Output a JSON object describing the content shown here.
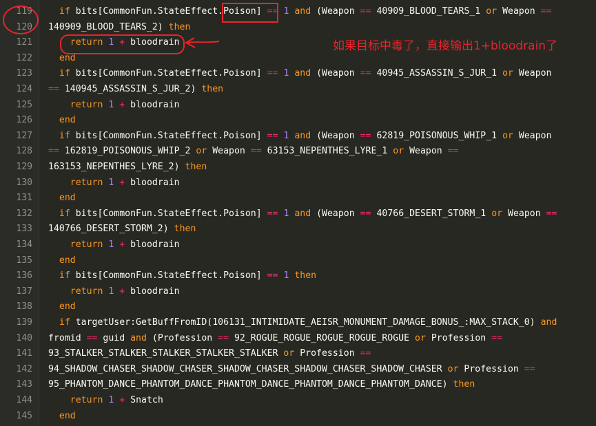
{
  "editor": {
    "line_numbers": [
      "119",
      "120",
      "121",
      "122",
      "123",
      "124",
      "125",
      "126",
      "127",
      "128",
      "129",
      "130",
      "131",
      "132",
      "133",
      "134",
      "135",
      "136",
      "137",
      "138",
      "139",
      "140",
      "141",
      "142",
      "143",
      "144",
      "145"
    ],
    "lines": [
      [
        {
          "t": "  ",
          "c": "id"
        },
        {
          "t": "if ",
          "c": "kw"
        },
        {
          "t": "bits[CommonFun.StateEffect.Poison] ",
          "c": "id"
        },
        {
          "t": "== ",
          "c": "kw2"
        },
        {
          "t": "1 ",
          "c": "num"
        },
        {
          "t": "and ",
          "c": "kw"
        },
        {
          "t": "(Weapon ",
          "c": "id"
        },
        {
          "t": "== ",
          "c": "kw2"
        },
        {
          "t": "40909_BLOOD_TEARS_1 ",
          "c": "id"
        },
        {
          "t": "or ",
          "c": "kw"
        },
        {
          "t": "Weapon ",
          "c": "id"
        },
        {
          "t": "==",
          "c": "kw2"
        }
      ],
      [
        {
          "t": "140909_BLOOD_TEARS_2) ",
          "c": "id"
        },
        {
          "t": "then",
          "c": "kw"
        }
      ],
      [
        {
          "t": "    ",
          "c": "id"
        },
        {
          "t": "return ",
          "c": "kw"
        },
        {
          "t": "1 ",
          "c": "num"
        },
        {
          "t": "+ ",
          "c": "kw2"
        },
        {
          "t": "bloodrain",
          "c": "id"
        }
      ],
      [
        {
          "t": "  ",
          "c": "id"
        },
        {
          "t": "end",
          "c": "kw"
        }
      ],
      [
        {
          "t": "  ",
          "c": "id"
        },
        {
          "t": "if ",
          "c": "kw"
        },
        {
          "t": "bits[CommonFun.StateEffect.Poison] ",
          "c": "id"
        },
        {
          "t": "== ",
          "c": "kw2"
        },
        {
          "t": "1 ",
          "c": "num"
        },
        {
          "t": "and ",
          "c": "kw"
        },
        {
          "t": "(Weapon ",
          "c": "id"
        },
        {
          "t": "== ",
          "c": "kw2"
        },
        {
          "t": "40945_ASSASSIN_S_JUR_1 ",
          "c": "id"
        },
        {
          "t": "or ",
          "c": "kw"
        },
        {
          "t": "Weapon",
          "c": "id"
        }
      ],
      [
        {
          "t": "== ",
          "c": "kw2"
        },
        {
          "t": "140945_ASSASSIN_S_JUR_2) ",
          "c": "id"
        },
        {
          "t": "then",
          "c": "kw"
        }
      ],
      [
        {
          "t": "    ",
          "c": "id"
        },
        {
          "t": "return ",
          "c": "kw"
        },
        {
          "t": "1 ",
          "c": "num"
        },
        {
          "t": "+ ",
          "c": "kw2"
        },
        {
          "t": "bloodrain",
          "c": "id"
        }
      ],
      [
        {
          "t": "  ",
          "c": "id"
        },
        {
          "t": "end",
          "c": "kw"
        }
      ],
      [
        {
          "t": "  ",
          "c": "id"
        },
        {
          "t": "if ",
          "c": "kw"
        },
        {
          "t": "bits[CommonFun.StateEffect.Poison] ",
          "c": "id"
        },
        {
          "t": "== ",
          "c": "kw2"
        },
        {
          "t": "1 ",
          "c": "num"
        },
        {
          "t": "and ",
          "c": "kw"
        },
        {
          "t": "(Weapon ",
          "c": "id"
        },
        {
          "t": "== ",
          "c": "kw2"
        },
        {
          "t": "62819_POISONOUS_WHIP_1 ",
          "c": "id"
        },
        {
          "t": "or ",
          "c": "kw"
        },
        {
          "t": "Weapon",
          "c": "id"
        }
      ],
      [
        {
          "t": "== ",
          "c": "kw2"
        },
        {
          "t": "162819_POISONOUS_WHIP_2 ",
          "c": "id"
        },
        {
          "t": "or ",
          "c": "kw"
        },
        {
          "t": "Weapon ",
          "c": "id"
        },
        {
          "t": "== ",
          "c": "kw2"
        },
        {
          "t": "63153_NEPENTHES_LYRE_1 ",
          "c": "id"
        },
        {
          "t": "or ",
          "c": "kw"
        },
        {
          "t": "Weapon ",
          "c": "id"
        },
        {
          "t": "==",
          "c": "kw2"
        }
      ],
      [
        {
          "t": "163153_NEPENTHES_LYRE_2) ",
          "c": "id"
        },
        {
          "t": "then",
          "c": "kw"
        }
      ],
      [
        {
          "t": "    ",
          "c": "id"
        },
        {
          "t": "return ",
          "c": "kw"
        },
        {
          "t": "1 ",
          "c": "num"
        },
        {
          "t": "+ ",
          "c": "kw2"
        },
        {
          "t": "bloodrain",
          "c": "id"
        }
      ],
      [
        {
          "t": "  ",
          "c": "id"
        },
        {
          "t": "end",
          "c": "kw"
        }
      ],
      [
        {
          "t": "  ",
          "c": "id"
        },
        {
          "t": "if ",
          "c": "kw"
        },
        {
          "t": "bits[CommonFun.StateEffect.Poison] ",
          "c": "id"
        },
        {
          "t": "== ",
          "c": "kw2"
        },
        {
          "t": "1 ",
          "c": "num"
        },
        {
          "t": "and ",
          "c": "kw"
        },
        {
          "t": "(Weapon ",
          "c": "id"
        },
        {
          "t": "== ",
          "c": "kw2"
        },
        {
          "t": "40766_DESERT_STORM_1 ",
          "c": "id"
        },
        {
          "t": "or ",
          "c": "kw"
        },
        {
          "t": "Weapon ",
          "c": "id"
        },
        {
          "t": "==",
          "c": "kw2"
        }
      ],
      [
        {
          "t": "140766_DESERT_STORM_2) ",
          "c": "id"
        },
        {
          "t": "then",
          "c": "kw"
        }
      ],
      [
        {
          "t": "    ",
          "c": "id"
        },
        {
          "t": "return ",
          "c": "kw"
        },
        {
          "t": "1 ",
          "c": "num"
        },
        {
          "t": "+ ",
          "c": "kw2"
        },
        {
          "t": "bloodrain",
          "c": "id"
        }
      ],
      [
        {
          "t": "  ",
          "c": "id"
        },
        {
          "t": "end",
          "c": "kw"
        }
      ],
      [
        {
          "t": "  ",
          "c": "id"
        },
        {
          "t": "if ",
          "c": "kw"
        },
        {
          "t": "bits[CommonFun.StateEffect.Poison] ",
          "c": "id"
        },
        {
          "t": "== ",
          "c": "kw2"
        },
        {
          "t": "1 ",
          "c": "num"
        },
        {
          "t": "then",
          "c": "kw"
        }
      ],
      [
        {
          "t": "    ",
          "c": "id"
        },
        {
          "t": "return ",
          "c": "kw"
        },
        {
          "t": "1 ",
          "c": "num"
        },
        {
          "t": "+ ",
          "c": "kw2"
        },
        {
          "t": "bloodrain",
          "c": "id"
        }
      ],
      [
        {
          "t": "  ",
          "c": "id"
        },
        {
          "t": "end",
          "c": "kw"
        }
      ],
      [
        {
          "t": "  ",
          "c": "id"
        },
        {
          "t": "if ",
          "c": "kw"
        },
        {
          "t": "targetUser:GetBuffFromID(106131_INTIMIDATE_AEISR_MONUMENT_DAMAGE_BONUS_:MAX_STACK_0) ",
          "c": "id"
        },
        {
          "t": "and",
          "c": "kw"
        }
      ],
      [
        {
          "t": "fromid ",
          "c": "id"
        },
        {
          "t": "== ",
          "c": "kw2"
        },
        {
          "t": "guid ",
          "c": "id"
        },
        {
          "t": "and ",
          "c": "kw"
        },
        {
          "t": "(Profession ",
          "c": "id"
        },
        {
          "t": "== ",
          "c": "kw2"
        },
        {
          "t": "92_ROGUE_ROGUE_ROGUE_ROGUE_ROGUE ",
          "c": "id"
        },
        {
          "t": "or ",
          "c": "kw"
        },
        {
          "t": "Profession ",
          "c": "id"
        },
        {
          "t": "==",
          "c": "kw2"
        }
      ],
      [
        {
          "t": "93_STALKER_STALKER_STALKER_STALKER_STALKER ",
          "c": "id"
        },
        {
          "t": "or ",
          "c": "kw"
        },
        {
          "t": "Profession ",
          "c": "id"
        },
        {
          "t": "==",
          "c": "kw2"
        }
      ],
      [
        {
          "t": "94_SHADOW_CHASER_SHADOW_CHASER_SHADOW_CHASER_SHADOW_CHASER_SHADOW_CHASER ",
          "c": "id"
        },
        {
          "t": "or ",
          "c": "kw"
        },
        {
          "t": "Profession ",
          "c": "id"
        },
        {
          "t": "==",
          "c": "kw2"
        }
      ],
      [
        {
          "t": "95_PHANTOM_DANCE_PHANTOM_DANCE_PHANTOM_DANCE_PHANTOM_DANCE_PHANTOM_DANCE) ",
          "c": "id"
        },
        {
          "t": "then",
          "c": "kw"
        }
      ],
      [
        {
          "t": "    ",
          "c": "id"
        },
        {
          "t": "return ",
          "c": "kw"
        },
        {
          "t": "1 ",
          "c": "num"
        },
        {
          "t": "+ ",
          "c": "kw2"
        },
        {
          "t": "Snatch",
          "c": "id"
        }
      ],
      [
        {
          "t": "  ",
          "c": "id"
        },
        {
          "t": "end",
          "c": "kw"
        }
      ]
    ]
  },
  "annotation": {
    "text": "如果目标中毒了，直接输出1+bloodrain了",
    "color": "#e8242c"
  },
  "colors": {
    "background": "#272822",
    "keyword": "#fc9720",
    "operator": "#f92672",
    "number": "#ae81ff",
    "text": "#f8f8f2",
    "line_number": "#8f908a",
    "markup_red": "#e8242c"
  }
}
